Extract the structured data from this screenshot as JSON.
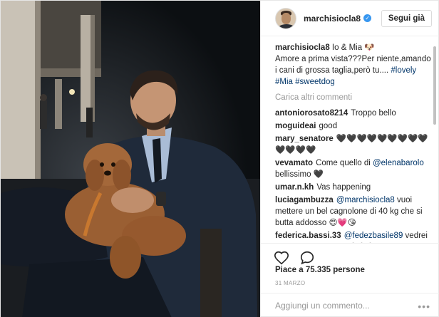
{
  "header": {
    "username": "marchisiocla8",
    "follow_label": "Segui già"
  },
  "caption": {
    "author": "marchisiocla8",
    "text_start": "Io & Mia 🐶",
    "text_rest": "Amore a prima vista???Per niente,amando i cani di grossa taglia,però tu.... ",
    "hashtags": [
      "#lovely",
      "#Mia",
      "#sweetdog"
    ]
  },
  "load_more": "Carica altri commenti",
  "comments": [
    {
      "author": "antoniorosato8214",
      "pre": "Troppo bello",
      "tag": "",
      "post": ""
    },
    {
      "author": "moguideai",
      "pre": "good",
      "tag": "",
      "post": ""
    },
    {
      "author": "mary_senatore",
      "pre": "🖤🖤🖤🖤🖤🖤🖤🖤🖤🖤🖤🖤🖤",
      "tag": "",
      "post": ""
    },
    {
      "author": "vevamato",
      "pre": "Come quello di ",
      "tag": "@elenabarolo",
      "post": " bellissimo 🖤"
    },
    {
      "author": "umar.n.kh",
      "pre": "Vas happening",
      "tag": "",
      "post": ""
    },
    {
      "author": "luciagambuzza",
      "pre": "",
      "tag": "@marchisiocla8",
      "post": " vuoi mettere un bel cagnolone di 40 kg che si butta addosso 😍💗😘"
    },
    {
      "author": "federica.bassi.33",
      "pre": "",
      "tag": "@fedezbasile89",
      "post": " vedrei bene anche te così! 😝😝😝"
    }
  ],
  "likes": "Piace a 75.335 persone",
  "date": "31 MARZO",
  "add_comment_placeholder": "Aggiungi un commento...",
  "more_label": "•••",
  "icons": {
    "like": "heart-outline-icon",
    "comment": "speech-bubble-icon",
    "verified": "verified-badge-icon",
    "more": "more-dots-icon"
  },
  "colors": {
    "link": "#003569",
    "verified": "#3897f0",
    "muted": "#999999"
  }
}
